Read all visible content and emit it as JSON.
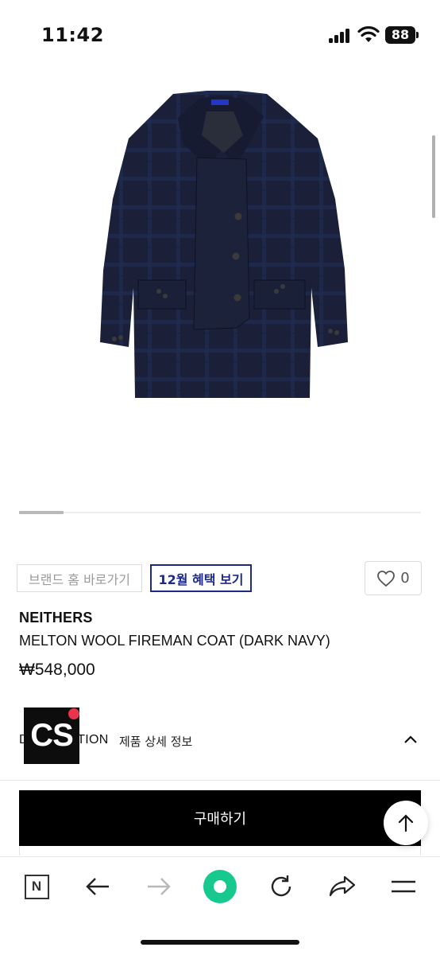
{
  "status": {
    "time": "11:42",
    "battery": "88"
  },
  "product": {
    "image_alt": "Dark navy wool fireman coat",
    "brand": "NEITHERS",
    "name": "MELTON WOOL FIREMAN COAT (DARK NAVY)",
    "price": "₩548,000",
    "like_count": "0"
  },
  "actions": {
    "brand_home": "브랜드 홈 바로가기",
    "promo": "12월 혜택 보기",
    "buy": "구매하기"
  },
  "description": {
    "title": "DESCRIPTION",
    "subtitle": "제품 상세 정보"
  },
  "badge": {
    "text": "CS"
  },
  "carousel": {
    "progress": 0.11
  },
  "toolbar": {
    "n_label": "N",
    "icons": [
      "n-logo-icon",
      "back-arrow-icon",
      "forward-arrow-icon",
      "home-dot-icon",
      "refresh-icon",
      "share-icon",
      "menu-icon"
    ]
  },
  "colors": {
    "promo_border": "#1e2a8a",
    "buy_bg": "#000000",
    "accent_green": "#18c98f",
    "badge_dot": "#e8344c"
  }
}
